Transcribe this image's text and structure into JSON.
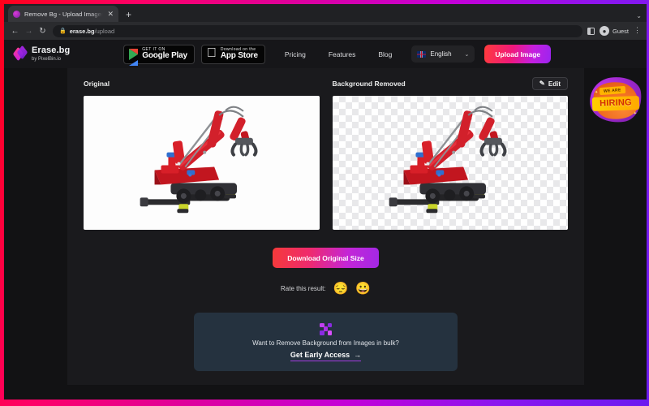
{
  "browser": {
    "tab": {
      "title": "Remove Bg - Upload Images t",
      "close_label": "✕",
      "favicon_name": "erasebg-favicon"
    },
    "newtab_label": "+",
    "tabstrip_chevron": "⌄",
    "back_label": "←",
    "forward_label": "→",
    "reload_label": "↻",
    "lock_label": "🔒",
    "url_domain": "erase.bg",
    "url_path": "/upload",
    "profile_label": "Guest",
    "avatar_glyph": "👤",
    "kebab_label": "⋮"
  },
  "header": {
    "brand_name": "Erase.bg",
    "brand_sub": "by PixelBin.io",
    "google_play": {
      "small": "GET IT ON",
      "big": "Google Play"
    },
    "app_store": {
      "small": "Download on the",
      "big": "App Store",
      "apple_glyph": ""
    },
    "nav": [
      {
        "label": "Pricing"
      },
      {
        "label": "Features"
      },
      {
        "label": "Blog"
      }
    ],
    "language": {
      "label": "English",
      "chevron": "⌄"
    },
    "upload_button": "Upload Image"
  },
  "hiring_badge": {
    "line1": "WE ARE",
    "line2": "HIRING"
  },
  "main": {
    "original": {
      "title": "Original"
    },
    "removed": {
      "title": "Background Removed",
      "edit_label": "Edit",
      "pencil_glyph": "✎"
    },
    "download_button": "Download Original Size",
    "rate": {
      "label": "Rate this result:",
      "negative_emoji": "😔",
      "positive_emoji": "😀"
    },
    "bulk_card": {
      "text": "Want to Remove Background from Images in bulk?",
      "cta": "Get Early Access",
      "cta_arrow": "→"
    }
  },
  "colors": {
    "accent_gradient_start": "#ff3b3b",
    "accent_gradient_end": "#9b25f0",
    "page_bg": "#121214",
    "panel_bg": "#1a1a1d",
    "bulk_card_bg": "#25323f",
    "cta_underline": "#a33ce0"
  }
}
